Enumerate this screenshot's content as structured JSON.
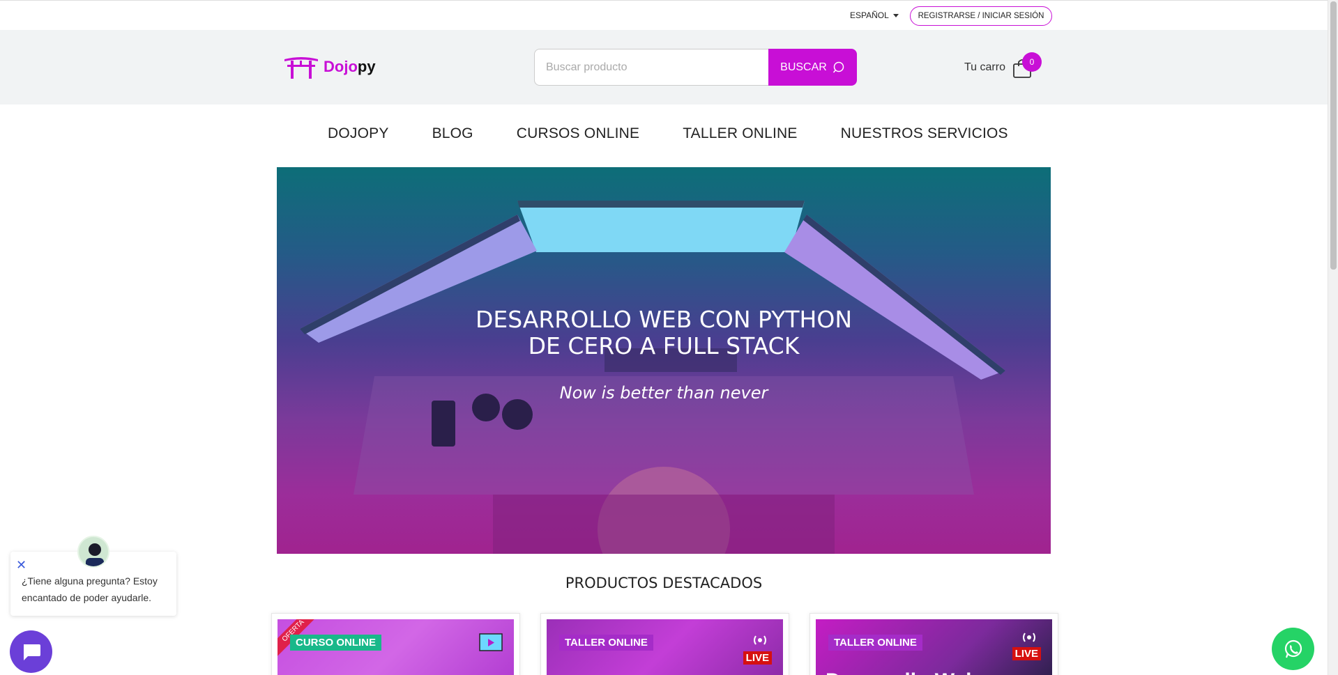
{
  "topbar": {
    "language": "ESPAÑOL",
    "login_label": "REGISTRARSE / INICIAR SESIÓN"
  },
  "header": {
    "logo_prefix": "Dojo",
    "logo_suffix": "py",
    "search_placeholder": "Buscar producto",
    "search_button": "BUSCAR",
    "cart_label": "Tu carro",
    "cart_count": "0"
  },
  "nav": {
    "items": [
      "DOJOPY",
      "BLOG",
      "CURSOS ONLINE",
      "TALLER ONLINE",
      "NUESTROS SERVICIOS"
    ]
  },
  "hero": {
    "title_line1": "DESARROLLO WEB CON PYTHON",
    "title_line2": "DE CERO A FULL STACK",
    "subtitle": "Now is better than never"
  },
  "featured": {
    "title": "PRODUCTOS DESTACADOS",
    "cards": [
      {
        "tag": "CURSO ONLINE",
        "ribbon": "OFERTA",
        "live": "",
        "bigtext": ""
      },
      {
        "tag": "TALLER ONLINE",
        "ribbon": "",
        "live": "LIVE",
        "bigtext": ""
      },
      {
        "tag": "TALLER ONLINE",
        "ribbon": "",
        "live": "LIVE",
        "bigtext": "Desarrollo Web"
      }
    ]
  },
  "chat": {
    "message": "¿Tiene alguna pregunta? Estoy encantado de poder ayudarle."
  },
  "colors": {
    "brand": "#c80fd6",
    "whatsapp": "#25d366",
    "chat": "#6b3fd8"
  }
}
